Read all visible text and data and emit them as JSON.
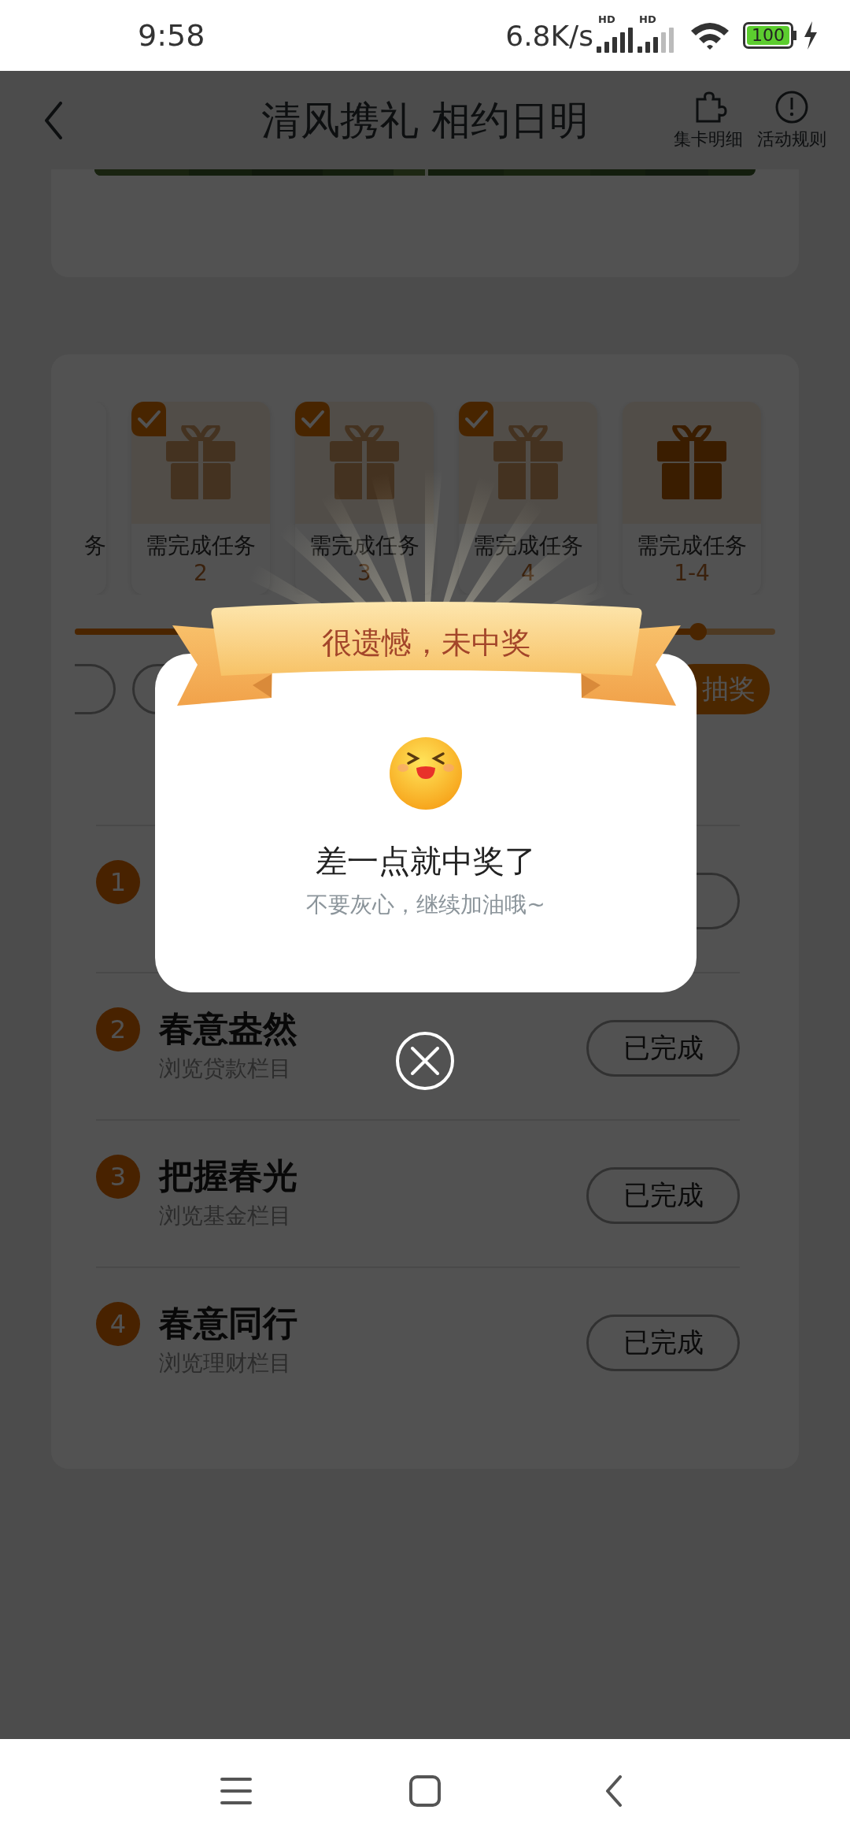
{
  "status_bar": {
    "time": "9:58",
    "net_speed": "6.8K/s",
    "signals": [
      {
        "label": "HD",
        "kind": "full"
      },
      {
        "label": "HD",
        "kind": "weak"
      }
    ],
    "battery": "100"
  },
  "header": {
    "title": "清风携礼 相约日明",
    "actions": [
      {
        "label": "集卡明细",
        "kind": "puzzle"
      },
      {
        "label": "活动规则",
        "kind": "info"
      }
    ]
  },
  "rewards": [
    {
      "kind": "partial",
      "label": "务",
      "checked": false
    },
    {
      "kind": "card",
      "label": "需完成任务",
      "number": "2",
      "checked": true
    },
    {
      "kind": "card",
      "label": "需完成任务",
      "number": "3",
      "checked": true
    },
    {
      "kind": "card",
      "label": "需完成任务",
      "number": "4",
      "checked": true
    },
    {
      "kind": "card",
      "label": "需完成任务",
      "number": "1-4",
      "checked": false
    }
  ],
  "progress": {
    "level": 0.89
  },
  "draw_button": {
    "label": "抽奖"
  },
  "tasks": [
    {
      "number": "1"
    },
    {
      "number": "2",
      "title": "春意盎然",
      "subtitle": "浏览贷款栏目",
      "status": "已完成"
    },
    {
      "number": "3",
      "title": "把握春光",
      "subtitle": "浏览基金栏目",
      "status": "已完成"
    },
    {
      "number": "4",
      "title": "春意同行",
      "subtitle": "浏览理财栏目",
      "status": "已完成"
    }
  ],
  "popup": {
    "ribbon": "很遗憾，未中奖",
    "title": "差一点就中奖了",
    "message": "不要灰心，继续加油哦~"
  }
}
